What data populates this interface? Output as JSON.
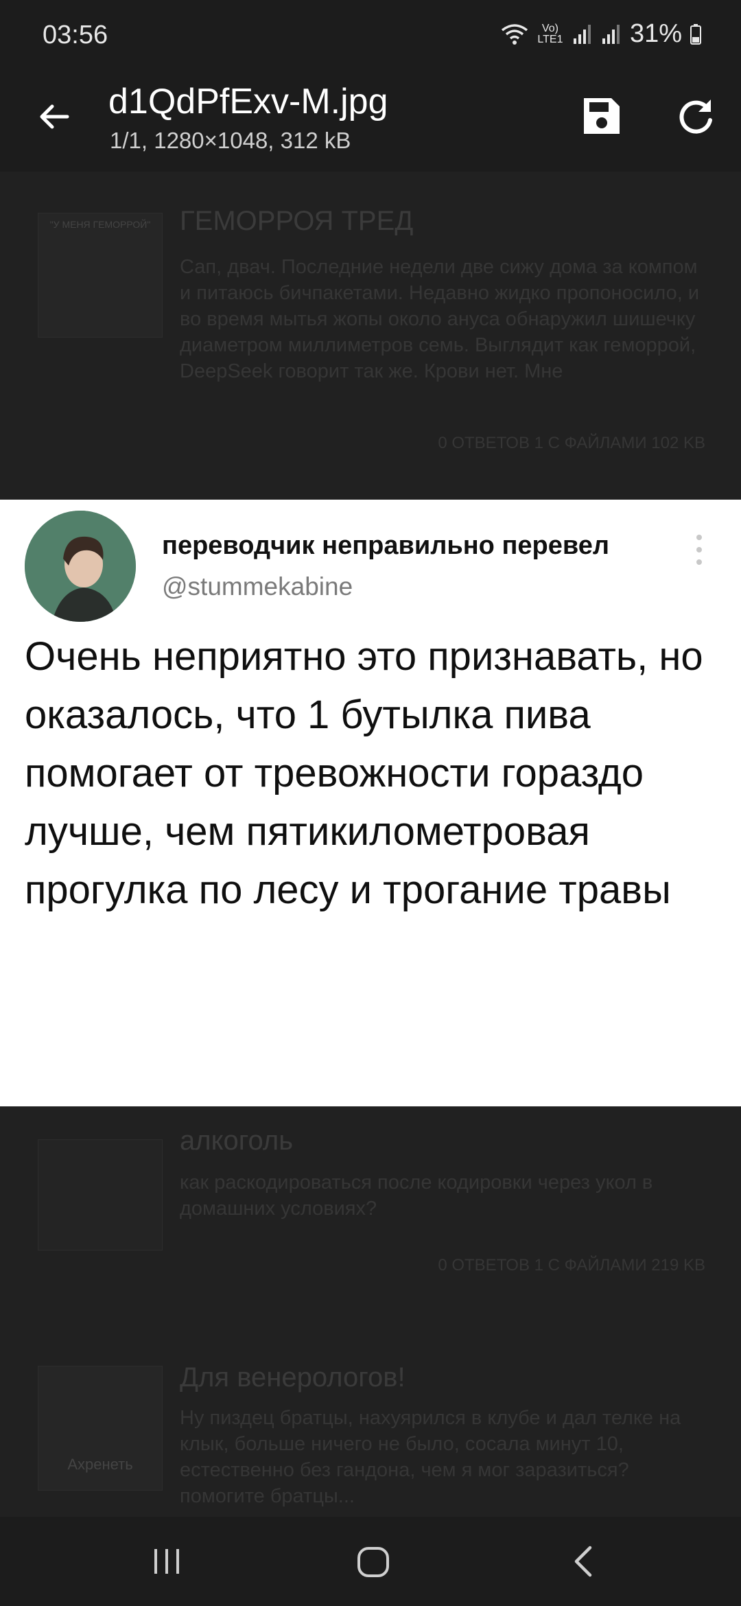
{
  "status": {
    "time": "03:56",
    "battery": "31%",
    "volte": "VoLTE1"
  },
  "toolbar": {
    "title": "d1QdPfExv-M.jpg",
    "subtitle": "1/1, 1280×1048, 312 kB"
  },
  "board": {
    "posts": [
      {
        "thumb_caption": "\"У МЕНЯ ГЕМОРРОЙ\"",
        "title": "ГЕМОРРОЯ ТРЕД",
        "text": "Сап, двач. Последние недели две сижу дома за компом и питаюсь бичпакетами. Недавно жидко пропоносило, и во время мытья жопы около ануса обнаружил шишечку диаметром миллиметров семь. Выглядит как геморрой, DeepSeek говорит так же. Крови нет. Мне",
        "meta": "0 ОТВЕТОВ  1 С ФАЙЛАМИ  102 KB"
      },
      {
        "title": "алкоголь",
        "text": "как раскодироваться после кодировки через укол в домашних условиях?",
        "meta": "0 ОТВЕТОВ  1 С ФАЙЛАМИ  219 KB"
      },
      {
        "thumb_caption": "Ахренеть",
        "title": "Для венерологов!",
        "text": "Ну пиздец братцы, нахуярился в клубе и дал телке на клык, больше ничего не было, сосала минут 10, естественно без гандона, чем я мог заразиться? помогите братцы..."
      }
    ]
  },
  "tweet": {
    "display_name": "переводчик неправильно перевел",
    "handle": "@stummekabine",
    "text": "Очень неприятно это признавать, но оказалось, что 1 бутылка пива помогает от тревожности гораздо лучше, чем пятикилометровая прогулка по лесу и трогание травы"
  },
  "colors": {
    "bar": "#1c1c1c",
    "card": "#ffffff",
    "text": "#0f0f0f",
    "handle": "#7a7a7a"
  }
}
